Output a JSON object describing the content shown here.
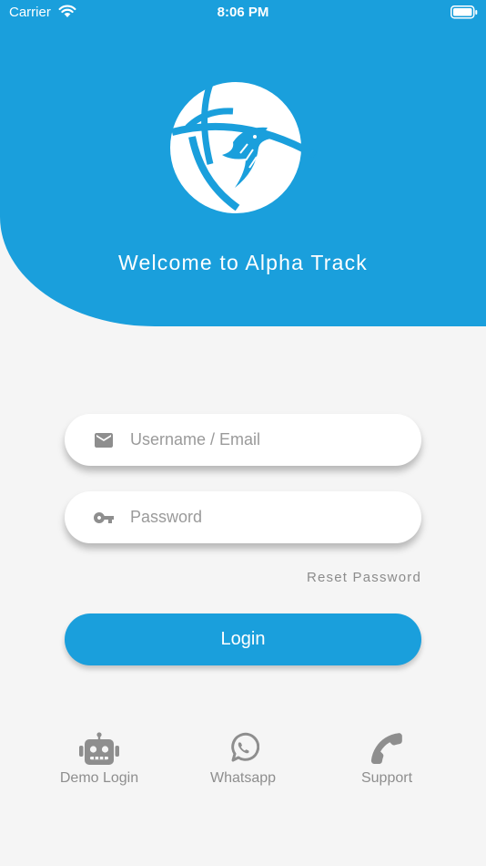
{
  "status_bar": {
    "carrier": "Carrier",
    "time": "8:06 PM",
    "icons": [
      "wifi-icon",
      "battery-icon"
    ]
  },
  "header": {
    "logo_icon": "eagle-globe-logo",
    "welcome_text": "Welcome to Alpha Track",
    "background_color": "#1a9fdc"
  },
  "form": {
    "username_placeholder": "Username / Email",
    "username_value": "",
    "username_icon": "email-icon",
    "password_placeholder": "Password",
    "password_value": "",
    "password_icon": "key-icon",
    "reset_password_label": "Reset Password",
    "login_label": "Login"
  },
  "quick_actions": [
    {
      "label": "Demo Login",
      "icon": "robot-icon"
    },
    {
      "label": "Whatsapp",
      "icon": "whatsapp-icon"
    },
    {
      "label": "Support",
      "icon": "phone-icon"
    }
  ],
  "colors": {
    "primary": "#1a9fdc",
    "background": "#f5f5f5",
    "muted_text": "#8e8e8e"
  }
}
